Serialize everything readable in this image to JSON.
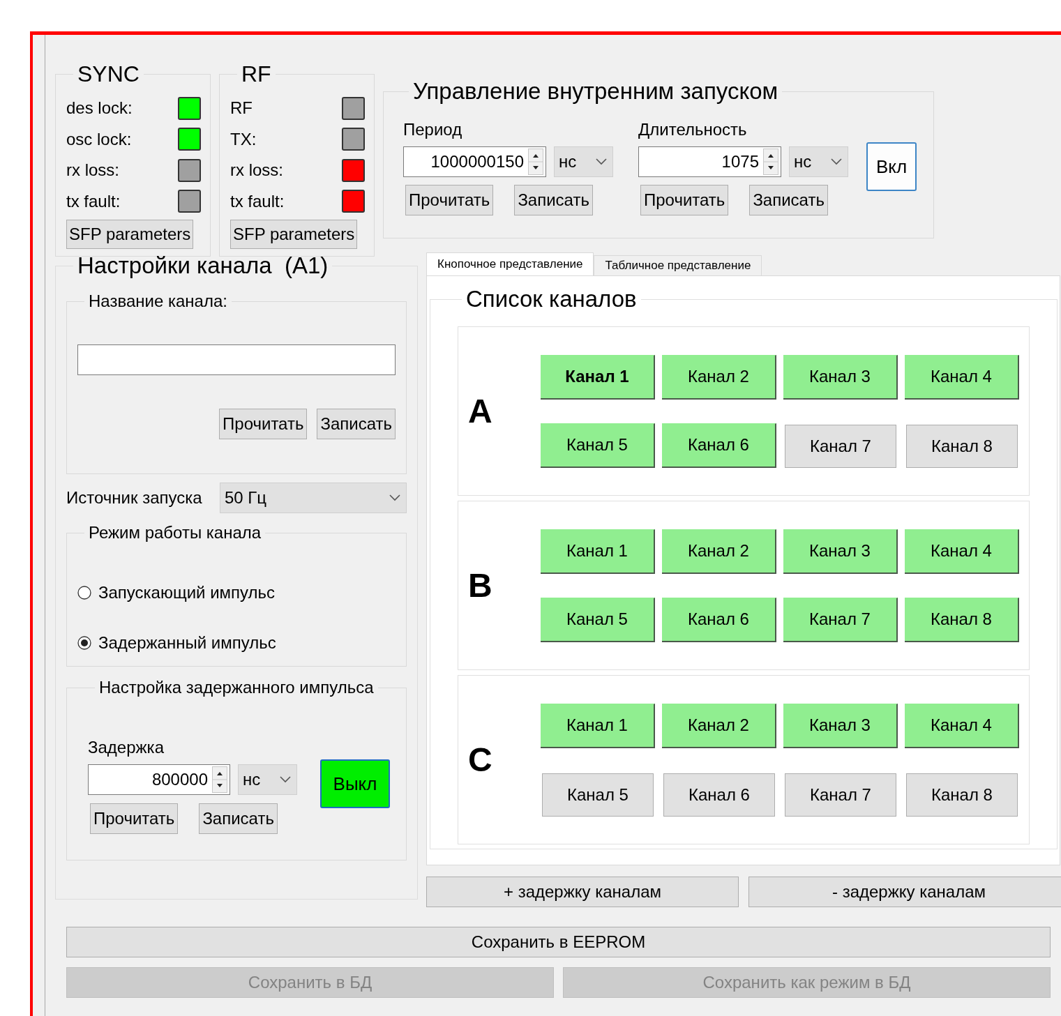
{
  "status_panels": [
    {
      "title": "SYNC",
      "indicators": [
        {
          "label": "des lock:",
          "color": "#00ff00"
        },
        {
          "label": "osc lock:",
          "color": "#00ff00"
        },
        {
          "label": "rx loss:",
          "color": "#a0a0a0"
        },
        {
          "label": "tx fault:",
          "color": "#a0a0a0"
        }
      ],
      "button": "SFP parameters"
    },
    {
      "title": "RF",
      "indicators": [
        {
          "label": "RF",
          "color": "#a0a0a0"
        },
        {
          "label": "TX:",
          "color": "#a0a0a0"
        },
        {
          "label": "rx loss:",
          "color": "#ff0000"
        },
        {
          "label": "tx fault:",
          "color": "#ff0000"
        }
      ],
      "button": "SFP parameters"
    }
  ],
  "trigger_control": {
    "title": "Управление внутренним запуском",
    "fields": [
      {
        "label": "Период",
        "value": "1000000150",
        "unit": "нс",
        "read": "Прочитать",
        "write": "Записать"
      },
      {
        "label": "Длительность",
        "value": "1075",
        "unit": "нс",
        "read": "Прочитать",
        "write": "Записать"
      }
    ],
    "toggle": {
      "label": "Вкл",
      "active": false
    }
  },
  "channel_settings": {
    "title": "Настройки канала  (A1)",
    "name_group": {
      "title": "Название канала:",
      "read": "Прочитать",
      "write": "Записать"
    },
    "trigger_source": {
      "label": "Источник запуска",
      "value": "50 Гц"
    },
    "mode_group": {
      "title": "Режим работы канала",
      "options": [
        {
          "label": "Запускающий импульс",
          "selected": false
        },
        {
          "label": "Задержанный импульс",
          "selected": true
        }
      ]
    },
    "delay_group": {
      "title": "Настройка задержанного импульса",
      "label": "Задержка",
      "value": "800000",
      "unit": "нс",
      "read": "Прочитать",
      "write": "Записать",
      "toggle": {
        "label": "Выкл",
        "active": true
      }
    }
  },
  "tabs": [
    {
      "label": "Кнопочное представление",
      "selected": true
    },
    {
      "label": "Табличное представление",
      "selected": false
    }
  ],
  "channel_list": {
    "title": "Список каналов",
    "groups": [
      {
        "letter": "A",
        "channels": [
          {
            "label": "Канал 1",
            "on": true,
            "selected": true
          },
          {
            "label": "Канал 2",
            "on": true,
            "selected": false
          },
          {
            "label": "Канал 3",
            "on": true,
            "selected": false
          },
          {
            "label": "Канал 4",
            "on": true,
            "selected": false
          },
          {
            "label": "Канал 5",
            "on": true,
            "selected": false
          },
          {
            "label": "Канал 6",
            "on": true,
            "selected": false
          },
          {
            "label": "Канал 7",
            "on": false,
            "selected": false
          },
          {
            "label": "Канал 8",
            "on": false,
            "selected": false
          }
        ]
      },
      {
        "letter": "B",
        "channels": [
          {
            "label": "Канал 1",
            "on": true,
            "selected": false
          },
          {
            "label": "Канал 2",
            "on": true,
            "selected": false
          },
          {
            "label": "Канал 3",
            "on": true,
            "selected": false
          },
          {
            "label": "Канал 4",
            "on": true,
            "selected": false
          },
          {
            "label": "Канал 5",
            "on": true,
            "selected": false
          },
          {
            "label": "Канал 6",
            "on": true,
            "selected": false
          },
          {
            "label": "Канал 7",
            "on": true,
            "selected": false
          },
          {
            "label": "Канал 8",
            "on": true,
            "selected": false
          }
        ]
      },
      {
        "letter": "C",
        "channels": [
          {
            "label": "Канал 1",
            "on": true,
            "selected": false
          },
          {
            "label": "Канал 2",
            "on": true,
            "selected": false
          },
          {
            "label": "Канал 3",
            "on": true,
            "selected": false
          },
          {
            "label": "Канал 4",
            "on": true,
            "selected": false
          },
          {
            "label": "Канал 5",
            "on": false,
            "selected": false
          },
          {
            "label": "Канал 6",
            "on": false,
            "selected": false
          },
          {
            "label": "Канал 7",
            "on": false,
            "selected": false
          },
          {
            "label": "Канал 8",
            "on": false,
            "selected": false
          }
        ]
      }
    ]
  },
  "delay_buttons": [
    "+ задержку каналам",
    "- задержку каналам"
  ],
  "bottom_buttons": [
    {
      "label": "Сохранить в EEPROM",
      "disabled": false
    },
    {
      "label": "Сохранить в БД",
      "disabled": true
    },
    {
      "label": "Сохранить как режим в БД",
      "disabled": true
    }
  ]
}
